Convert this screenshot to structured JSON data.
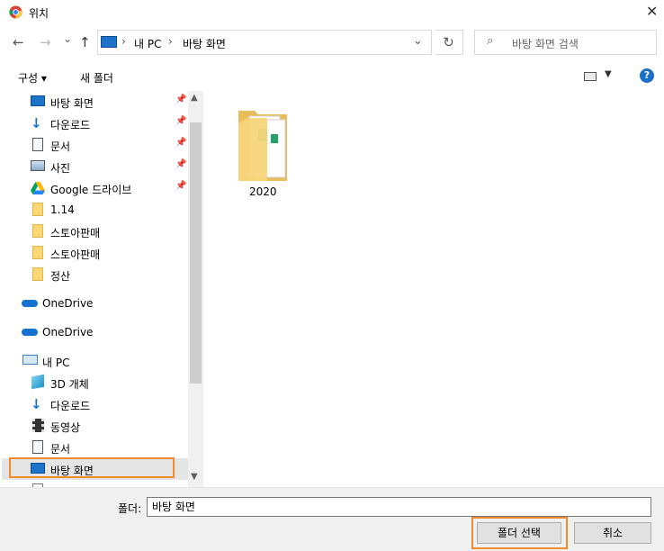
{
  "window": {
    "title": "위치",
    "close_glyph": "✕"
  },
  "nav": {
    "back_glyph": "←",
    "forward_glyph": "→",
    "recent_glyph": "⌄",
    "up_glyph": "↑",
    "breadcrumb": [
      "내 PC",
      "바탕 화면"
    ],
    "refresh_glyph": "↻",
    "search_placeholder": "바탕 화면 검색"
  },
  "toolbar": {
    "organize": "구성 ▾",
    "new_folder": "새 폴더",
    "help": "?"
  },
  "sidebar": {
    "quick_access": [
      {
        "label": "바탕 화면",
        "icon": "desktop-icon",
        "pinned": true
      },
      {
        "label": "다운로드",
        "icon": "download-icon",
        "pinned": true
      },
      {
        "label": "문서",
        "icon": "document-icon",
        "pinned": true
      },
      {
        "label": "사진",
        "icon": "picture-icon",
        "pinned": true
      },
      {
        "label": "Google 드라이브",
        "icon": "google-drive-icon",
        "pinned": true
      },
      {
        "label": "1.14",
        "icon": "folder-icon",
        "pinned": false
      },
      {
        "label": "스토아판매",
        "icon": "folder-icon",
        "pinned": false
      },
      {
        "label": "스토아판매",
        "icon": "folder-icon",
        "pinned": false
      },
      {
        "label": "정산",
        "icon": "folder-icon",
        "pinned": false
      }
    ],
    "onedrive": [
      "OneDrive",
      "OneDrive"
    ],
    "this_pc": {
      "label": "내 PC",
      "items": [
        {
          "label": "3D 개체",
          "icon": "3d-objects-icon"
        },
        {
          "label": "다운로드",
          "icon": "download-icon"
        },
        {
          "label": "동영상",
          "icon": "video-icon"
        },
        {
          "label": "문서",
          "icon": "document-icon"
        },
        {
          "label": "바탕 화면",
          "icon": "desktop-icon",
          "selected": true
        }
      ]
    }
  },
  "content": {
    "items": [
      {
        "name": "2020",
        "type": "folder"
      }
    ]
  },
  "footer": {
    "folder_label": "폴더:",
    "folder_value": "바탕 화면",
    "select_button": "폴더 선택",
    "cancel_button": "취소"
  },
  "colors": {
    "highlight": "#f08a2c",
    "selection": "#e5e5e5",
    "accent": "#0078d7"
  }
}
